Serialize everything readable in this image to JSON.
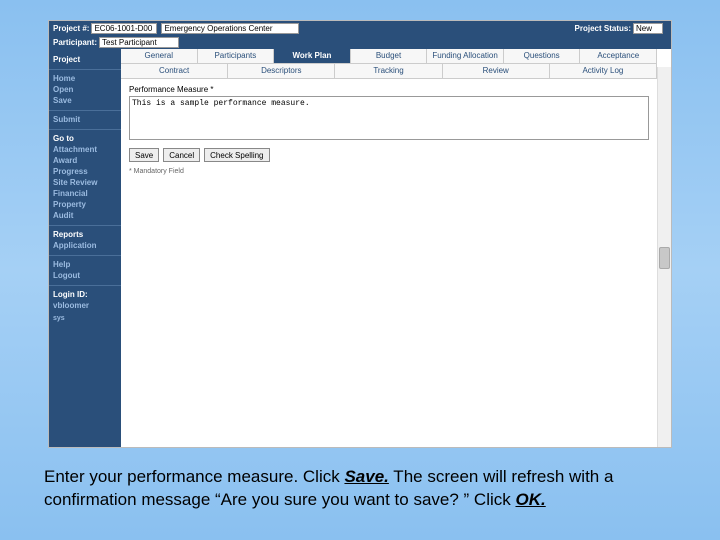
{
  "header": {
    "row1": {
      "project_num_label": "Project #:",
      "project_num_value": "EC06-1001-D00",
      "project_name_value": "Emergency Operations Center",
      "status_label": "Project Status:",
      "status_value": "New"
    },
    "row2": {
      "participant_label": "Participant:",
      "participant_value": "Test Participant"
    }
  },
  "sidebar": {
    "groups": [
      {
        "items": [
          {
            "label": "Project",
            "cls": "white"
          }
        ]
      },
      {
        "items": [
          {
            "label": "Home",
            "cls": "dim"
          },
          {
            "label": "Open",
            "cls": "dim"
          },
          {
            "label": "Save",
            "cls": "dim"
          }
        ]
      },
      {
        "items": [
          {
            "label": "Submit",
            "cls": "dim"
          }
        ]
      },
      {
        "items": [
          {
            "label": "Go to",
            "cls": "white"
          },
          {
            "label": "Attachment",
            "cls": "dim"
          },
          {
            "label": "Award",
            "cls": "dim"
          },
          {
            "label": "Progress",
            "cls": "dim"
          },
          {
            "label": "Site Review",
            "cls": "dim"
          },
          {
            "label": "Financial",
            "cls": "dim"
          },
          {
            "label": "Property",
            "cls": "dim"
          },
          {
            "label": "Audit",
            "cls": "dim"
          }
        ]
      },
      {
        "items": [
          {
            "label": "Reports",
            "cls": "white"
          },
          {
            "label": "Application",
            "cls": "dim"
          }
        ]
      },
      {
        "items": [
          {
            "label": "Help",
            "cls": "dim"
          },
          {
            "label": "Logout",
            "cls": "dim"
          }
        ]
      },
      {
        "items": [
          {
            "label": "Login ID:",
            "cls": "white"
          },
          {
            "label": "vbloomer",
            "cls": "dim"
          }
        ]
      }
    ],
    "footer": "sys"
  },
  "tabs": {
    "primary": [
      "General",
      "Participants",
      "Work Plan",
      "Budget",
      "Funding Allocation",
      "Questions",
      "Acceptance"
    ],
    "primary_active": 2,
    "secondary": [
      "Contract",
      "Descriptors",
      "Tracking",
      "Review",
      "Activity Log"
    ]
  },
  "form": {
    "field_label": "Performance Measure *",
    "textarea_value": "This is a sample performance measure.",
    "buttons": {
      "save": "Save",
      "cancel": "Cancel",
      "spell": "Check Spelling"
    },
    "mandatory_note": "*  Mandatory Field"
  },
  "caption": {
    "t1": "Enter your performance measure.  Click ",
    "save": "Save.",
    "t2": "  The screen will refresh with a confirmation message “Are you sure you want to save? ” Click ",
    "ok": "OK.",
    "t3": ""
  }
}
